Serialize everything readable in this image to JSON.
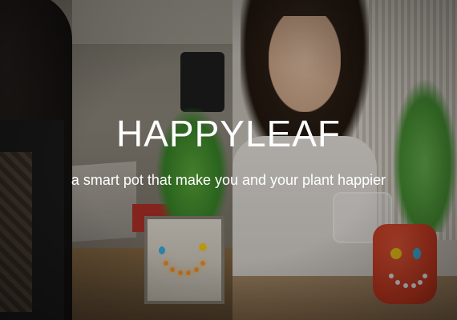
{
  "hero": {
    "title": "HAPPYLEAF",
    "subtitle": "a smart pot that make you and your plant happier"
  },
  "colors": {
    "text": "#ffffff",
    "pot_right_red": "#d33b22",
    "leaf_green": "#4b9a36",
    "smile_led": "#ff9a2a"
  }
}
